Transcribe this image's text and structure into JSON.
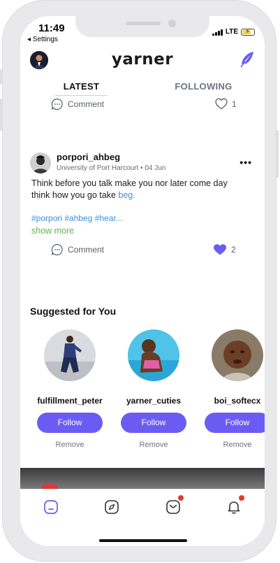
{
  "status_bar": {
    "time": "11:49",
    "back_label": "◂ Settings",
    "network": "LTE"
  },
  "header": {
    "logo": "yarner"
  },
  "tabs": [
    {
      "label": "LATEST",
      "active": true
    },
    {
      "label": "FOLLOWING",
      "active": false
    }
  ],
  "previous_post": {
    "comment_label": "Comment",
    "like_count": "1"
  },
  "post": {
    "username": "porpori_ahbeg",
    "school": "University of Port Harcourt",
    "separator": "•",
    "date": "04 Jun",
    "more_label": "•••",
    "text_line1": "Think before you talk make you nor later come day",
    "text_line2": "think how you go take",
    "text_link": "beg.",
    "hashtags": "#porpori #ahbeg #hear...",
    "show_more": "show more",
    "comment_label": "Comment",
    "like_count": "2"
  },
  "suggested": {
    "title": "Suggested for You",
    "users": [
      {
        "name": "fulfillment_peter",
        "follow_label": "Follow",
        "remove_label": "Remove"
      },
      {
        "name": "yarner_cuties",
        "follow_label": "Follow",
        "remove_label": "Remove"
      },
      {
        "name": "boi_softecx",
        "follow_label": "Follow",
        "remove_label": "Remove"
      }
    ]
  },
  "colors": {
    "accent": "#6a5cf2",
    "link": "#3d8fe0",
    "show_more": "#58b84a",
    "badge": "#e53935"
  },
  "bottom_nav": [
    {
      "icon": "home-icon",
      "active": true
    },
    {
      "icon": "compass-icon",
      "active": false
    },
    {
      "icon": "messages-icon",
      "badge": true
    },
    {
      "icon": "bell-icon",
      "badge": true
    }
  ]
}
